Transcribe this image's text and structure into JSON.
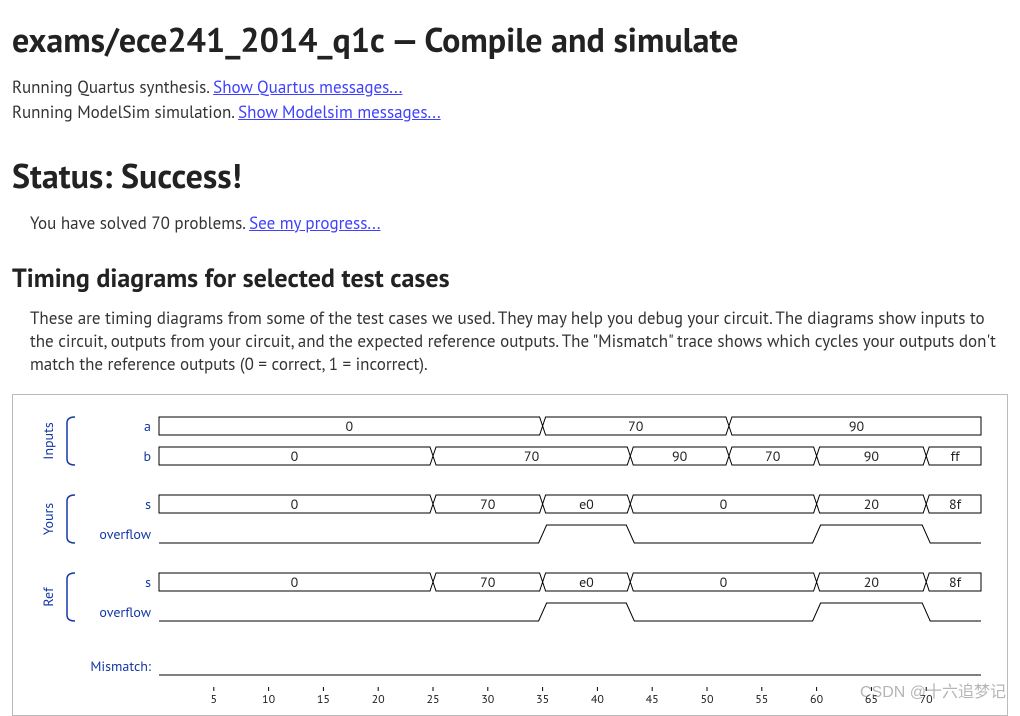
{
  "title": "exams/ece241_2014_q1c — Compile and simulate",
  "log": {
    "quartus_prefix": "Running Quartus synthesis. ",
    "quartus_link": "Show Quartus messages...",
    "modelsim_prefix": "Running ModelSim simulation. ",
    "modelsim_link": "Show Modelsim messages..."
  },
  "status_heading": "Status: Success!",
  "progress": {
    "prefix": "You have solved 70 problems. ",
    "link": "See my progress..."
  },
  "timing_heading": "Timing diagrams for selected test cases",
  "timing_desc": "These are timing diagrams from some of the test cases we used. They may help you debug your circuit. The diagrams show inputs to the circuit, outputs from your circuit, and the expected reference outputs. The \"Mismatch\" trace shows which cycles your outputs don't match the reference outputs (0 = correct, 1 = incorrect).",
  "watermark": "CSDN @十六追梦记",
  "chart_data": {
    "type": "timing",
    "axis_ticks": [
      5,
      10,
      15,
      20,
      25,
      30,
      35,
      40,
      45,
      50,
      55,
      60,
      65,
      70
    ],
    "groups": [
      {
        "name": "Inputs",
        "signals": [
          {
            "name": "a",
            "kind": "bus",
            "segments": [
              {
                "from": 0,
                "to": 35,
                "value": "0"
              },
              {
                "from": 35,
                "to": 52,
                "value": "70"
              },
              {
                "from": 52,
                "to": 75,
                "value": "90"
              }
            ]
          },
          {
            "name": "b",
            "kind": "bus",
            "segments": [
              {
                "from": 0,
                "to": 25,
                "value": "0"
              },
              {
                "from": 25,
                "to": 43,
                "value": "70"
              },
              {
                "from": 43,
                "to": 52,
                "value": "90"
              },
              {
                "from": 52,
                "to": 60,
                "value": "70"
              },
              {
                "from": 60,
                "to": 70,
                "value": "90"
              },
              {
                "from": 70,
                "to": 75,
                "value": "ff"
              }
            ]
          }
        ]
      },
      {
        "name": "Yours",
        "signals": [
          {
            "name": "s",
            "kind": "bus",
            "segments": [
              {
                "from": 0,
                "to": 25,
                "value": "0"
              },
              {
                "from": 25,
                "to": 35,
                "value": "70"
              },
              {
                "from": 35,
                "to": 43,
                "value": "e0"
              },
              {
                "from": 43,
                "to": 60,
                "value": "0"
              },
              {
                "from": 60,
                "to": 70,
                "value": "20"
              },
              {
                "from": 70,
                "to": 75,
                "value": "8f"
              }
            ]
          },
          {
            "name": "overflow",
            "kind": "bit",
            "edges": [
              {
                "at": 0,
                "level": 0
              },
              {
                "at": 35,
                "level": 1
              },
              {
                "at": 43,
                "level": 0
              },
              {
                "at": 60,
                "level": 1
              },
              {
                "at": 70,
                "level": 0
              }
            ],
            "end": 75
          }
        ]
      },
      {
        "name": "Ref",
        "signals": [
          {
            "name": "s",
            "kind": "bus",
            "segments": [
              {
                "from": 0,
                "to": 25,
                "value": "0"
              },
              {
                "from": 25,
                "to": 35,
                "value": "70"
              },
              {
                "from": 35,
                "to": 43,
                "value": "e0"
              },
              {
                "from": 43,
                "to": 60,
                "value": "0"
              },
              {
                "from": 60,
                "to": 70,
                "value": "20"
              },
              {
                "from": 70,
                "to": 75,
                "value": "8f"
              }
            ]
          },
          {
            "name": "overflow",
            "kind": "bit",
            "edges": [
              {
                "at": 0,
                "level": 0
              },
              {
                "at": 35,
                "level": 1
              },
              {
                "at": 43,
                "level": 0
              },
              {
                "at": 60,
                "level": 1
              },
              {
                "at": 70,
                "level": 0
              }
            ],
            "end": 75
          }
        ]
      }
    ],
    "mismatch": {
      "name": "Mismatch:",
      "kind": "flat",
      "level": 0,
      "from": 0,
      "to": 75
    }
  }
}
